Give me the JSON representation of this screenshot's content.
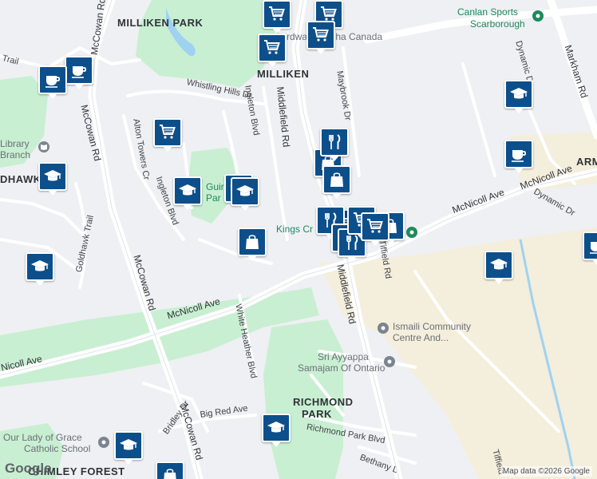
{
  "map": {
    "colors": {
      "background": "#eef0f3",
      "park": "#c9efd2",
      "industrial": "#f4eedc",
      "road": "#ffffff",
      "water": "#9fd2f0",
      "marker": "#0d4f8b"
    },
    "areas": [
      "MILLIKEN PARK",
      "MILLIKEN",
      "RICHMOND PARK",
      "CHIMLEY FOREST"
    ],
    "area_fragments": {
      "goldhawk": "DHAWK",
      "armadale": "ARM"
    },
    "roads": {
      "mccowan_north": "McCowan Rd",
      "mccowan_mid": "McCowan Rd",
      "mccowan_south": "McCowan Rd",
      "mcnicoll_west": "McNicoll Ave",
      "mcnicoll_east": "McNicoll Ave",
      "mcnicoll_far_east": "McNicoll Ave",
      "mcnicoll_south": "Nicoll Ave",
      "middlefield_north": "Middlefield Rd",
      "middlefield_south": "Middlefield Rd",
      "markham": "Markham Rd",
      "whistling_hills": "Whistling Hills Dr",
      "ingleton_blvd_n": "Ingleton Blvd",
      "ingleton_blvd_s": "Ingleton Blvd",
      "alton_towers": "Alton Towers Cr",
      "goldhawk_trail": "Goldhawk Trail",
      "maybrook": "Maybrook Dr",
      "dynamic_dr_n": "Dynamic Dr",
      "dynamic_dr_e": "Dynamic Dr",
      "tiffield": "Tiffield Rd",
      "tiffield_s": "Tiffield",
      "white_heather": "White Heather Blvd",
      "bridley": "Bridley Dr",
      "big_red": "Big Red Ave",
      "richmond_park_blvd": "Richmond Park Blvd",
      "bethany": "Bethany L",
      "trail_nw": "Trail"
    },
    "places": {
      "canlan": "Canlan Sports",
      "canlan_2": "Scarborough",
      "gurdwara": "Gurdwara Sabha Canada",
      "library_1": "Library",
      "library_2": "Branch",
      "kings": "Kings Cr",
      "ismaili_1": "Ismaili Community",
      "ismaili_2": "Centre And...",
      "ayyappa_1": "Sri Ayyappa",
      "ayyappa_2": "Samajam Of Ontario",
      "lady_grace_1": "Our Lady of Grace",
      "lady_grace_2": "Catholic School",
      "park_a": "Guirla",
      "park_b": "Par"
    },
    "markers": [
      {
        "name": "grocery",
        "icon": "cart-icon"
      },
      {
        "name": "grocery",
        "icon": "cart-icon"
      },
      {
        "name": "grocery",
        "icon": "cart-icon"
      },
      {
        "name": "grocery",
        "icon": "cart-icon"
      },
      {
        "name": "grocery",
        "icon": "cart-icon"
      },
      {
        "name": "grocery",
        "icon": "cart-icon"
      },
      {
        "name": "cafe",
        "icon": "coffee-icon"
      },
      {
        "name": "cafe",
        "icon": "coffee-icon"
      },
      {
        "name": "cafe",
        "icon": "coffee-icon"
      },
      {
        "name": "cafe",
        "icon": "coffee-icon"
      },
      {
        "name": "school",
        "icon": "school-icon"
      },
      {
        "name": "school",
        "icon": "school-icon"
      },
      {
        "name": "school",
        "icon": "school-icon"
      },
      {
        "name": "school",
        "icon": "school-icon"
      },
      {
        "name": "school",
        "icon": "school-icon"
      },
      {
        "name": "school",
        "icon": "school-icon"
      },
      {
        "name": "school",
        "icon": "school-icon"
      },
      {
        "name": "school",
        "icon": "school-icon"
      },
      {
        "name": "school",
        "icon": "school-icon"
      },
      {
        "name": "shopping",
        "icon": "bag-icon"
      },
      {
        "name": "shopping",
        "icon": "bag-icon"
      },
      {
        "name": "shopping",
        "icon": "bag-icon"
      },
      {
        "name": "shopping",
        "icon": "bag-icon"
      },
      {
        "name": "restaurant",
        "icon": "fork-knife-icon"
      },
      {
        "name": "restaurant",
        "icon": "fork-knife-icon"
      },
      {
        "name": "restaurant",
        "icon": "fork-knife-icon"
      },
      {
        "name": "restaurant",
        "icon": "fork-knife-icon"
      },
      {
        "name": "grocery",
        "icon": "cart-icon"
      },
      {
        "name": "grocery",
        "icon": "cart-icon"
      },
      {
        "name": "shopping",
        "icon": "bag-icon"
      }
    ],
    "attribution": "Map data ©2026 Google",
    "logo": "Google"
  }
}
